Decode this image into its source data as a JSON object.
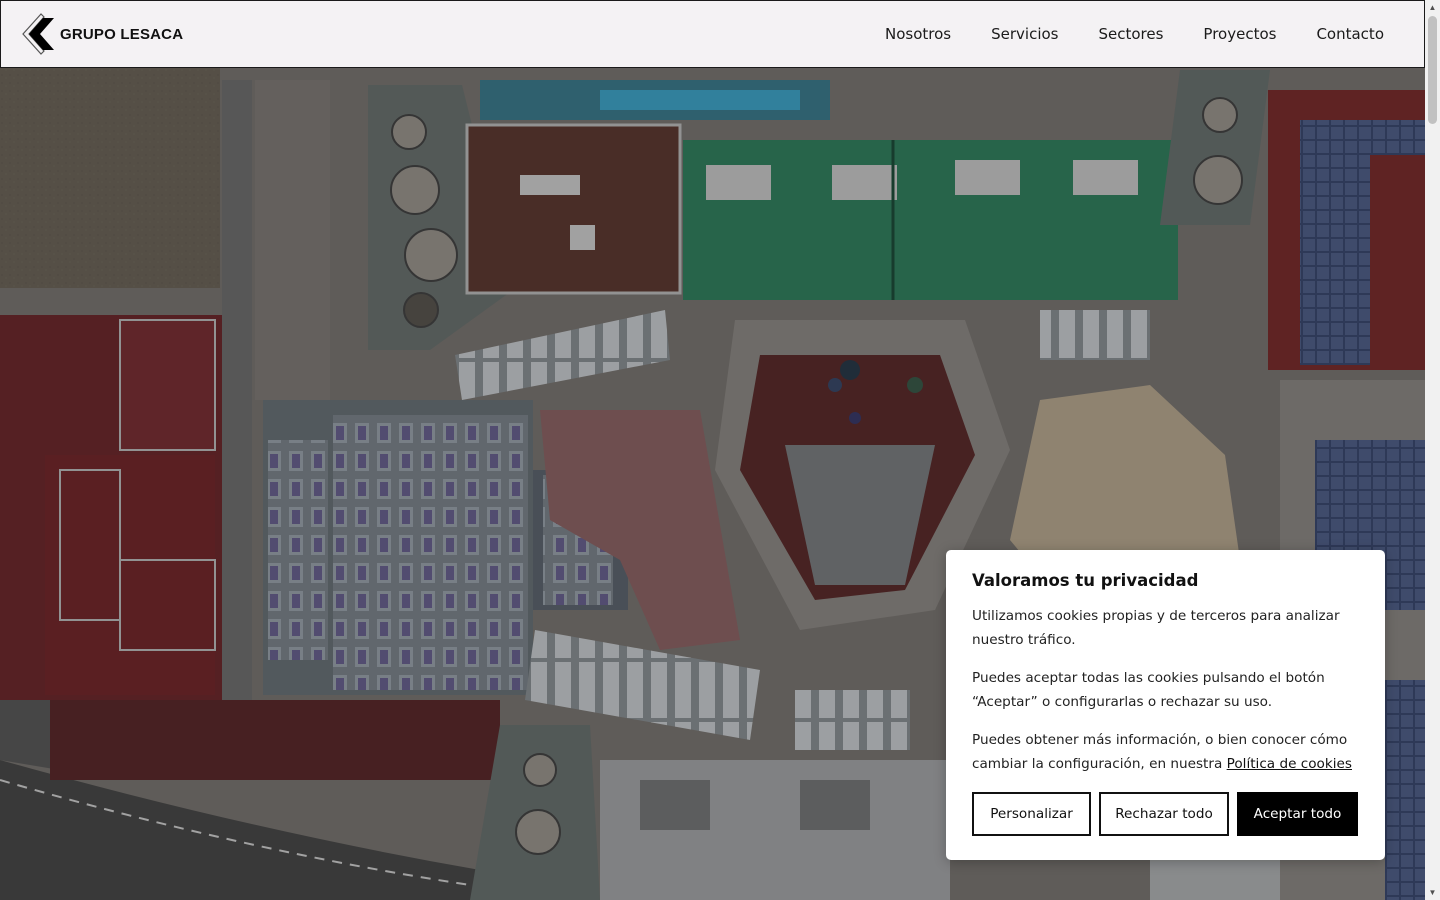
{
  "header": {
    "logo_text": "GRUPO LESACA",
    "nav": [
      {
        "label": "Nosotros"
      },
      {
        "label": "Servicios"
      },
      {
        "label": "Sectores"
      },
      {
        "label": "Proyectos"
      },
      {
        "label": "Contacto"
      }
    ]
  },
  "cookie_banner": {
    "title": "Valoramos tu privacidad",
    "paragraph_1": "Utilizamos cookies propias y de terceros para analizar nuestro tráfico.",
    "paragraph_2": "Puedes aceptar todas las cookies pulsando el botón “Aceptar” o configurarlas o rechazar su uso.",
    "paragraph_3_prefix": "Puedes obtener más información, o bien conocer cómo cambiar la configuración, en nuestra",
    "policy_link": "Política de cookies",
    "buttons": {
      "customize": "Personalizar",
      "reject": "Rechazar todo",
      "accept": "Aceptar todo"
    }
  },
  "colors": {
    "header_bg": "#f4f2f4",
    "accept_bg": "#000000",
    "text": "#111111"
  },
  "icons": {
    "logo_mark": "chevron-left-logo-icon",
    "scroll_up": "triangle-up-icon",
    "scroll_down": "triangle-down-icon"
  }
}
